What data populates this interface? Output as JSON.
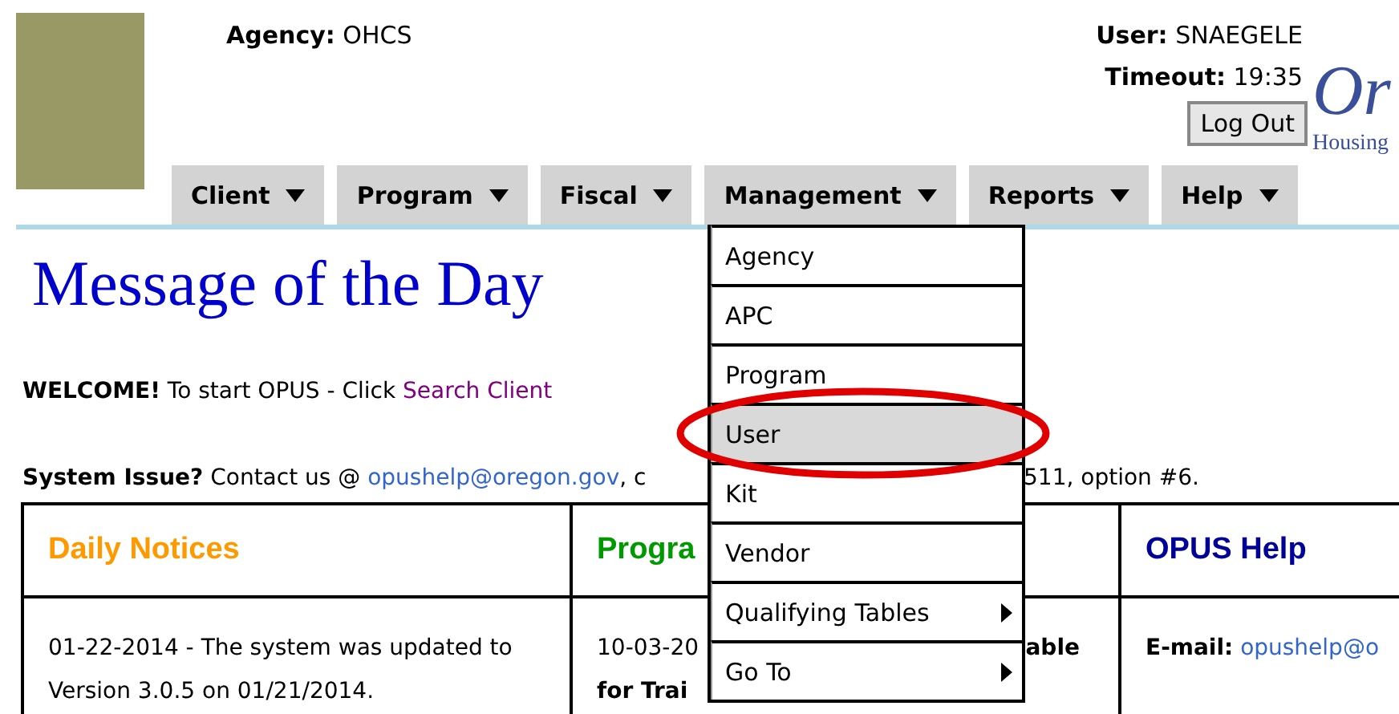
{
  "header": {
    "agency_label": "Agency:",
    "agency": "OHCS",
    "user_label": "User:",
    "user": "SNAEGELE",
    "timeout_label": "Timeout:",
    "timeout": "19:35",
    "logout_button": "Log Out",
    "logo_text": "Or",
    "logo_subtext": "Housing"
  },
  "nav": [
    "Client",
    "Program",
    "Fiscal",
    "Management",
    "Reports",
    "Help"
  ],
  "menu": {
    "items": [
      {
        "label": "Agency",
        "selected": false,
        "submenu": false
      },
      {
        "label": "APC",
        "selected": false,
        "submenu": false
      },
      {
        "label": "Program",
        "selected": false,
        "submenu": false
      },
      {
        "label": "User",
        "selected": true,
        "submenu": false
      },
      {
        "label": "Kit",
        "selected": false,
        "submenu": false
      },
      {
        "label": "Vendor",
        "selected": false,
        "submenu": false
      },
      {
        "label": "Qualifying Tables",
        "selected": false,
        "submenu": true
      },
      {
        "label": "Go To",
        "selected": false,
        "submenu": true
      }
    ]
  },
  "title": "Message of the Day",
  "welcome": {
    "text": "**WELCOME!** To start OPUS - Click ",
    "link": "Search Client"
  },
  "system_issue": {
    "text": "**System Issue?** Contact us @ ",
    "link": "opushelp@oregon.gov",
    "after": ", c",
    "tail": "511, option #6."
  },
  "table": {
    "columns": [
      {
        "title": "Daily Notices",
        "color": "#ff9900"
      },
      {
        "title": "Progra",
        "color": "#009900"
      },
      {
        "title": "OPUS Help",
        "color": "#000099"
      }
    ],
    "notice": "01-22-2014 - The system was updated to Version 3.0.5 on 01/21/2014.",
    "program": {
      "left": "10-03-20",
      "right": "able",
      "line2": "for Trai"
    },
    "help": {
      "label": "E-mail:",
      "link": "opushelp@o"
    }
  }
}
